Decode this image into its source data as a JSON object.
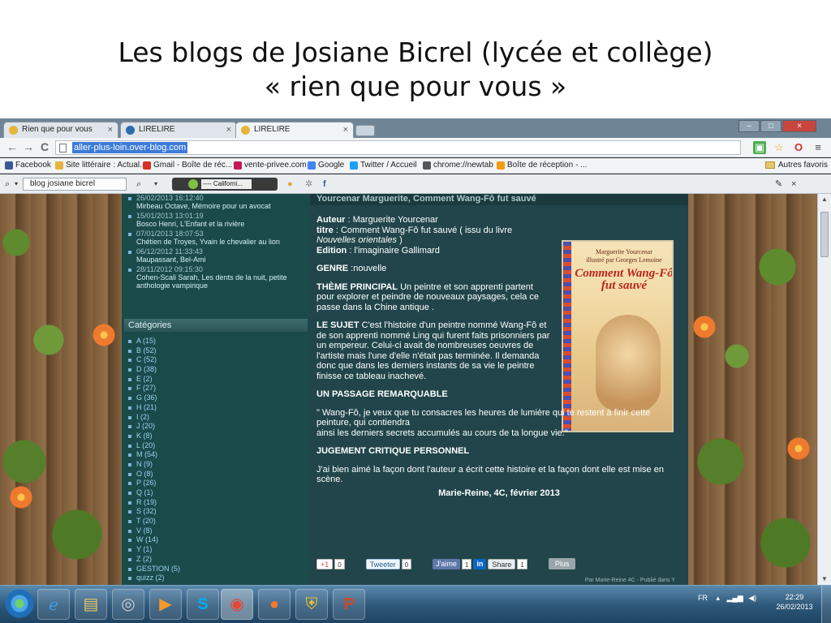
{
  "slide": {
    "title_line1": "Les blogs de Josiane Bicrel (lycée et collège)",
    "title_line2": "« rien que pour vous »"
  },
  "browser": {
    "tabs": [
      {
        "label": "Rien que pour vous",
        "active": false
      },
      {
        "label": "LIRELIRE",
        "active": false
      },
      {
        "label": "LIRELIRE",
        "active": true
      }
    ],
    "tab_close": "×",
    "window_controls": {
      "minimize": "–",
      "maximize": "□",
      "close": "×"
    },
    "nav": {
      "back": "←",
      "forward": "→",
      "reload": "C"
    },
    "url": "aller-plus-loin.over-blog.com",
    "bookmarks": [
      {
        "label": "Facebook",
        "color": "#3b5998"
      },
      {
        "label": "Site littéraire : Actual...",
        "color": "#e8b43a"
      },
      {
        "label": "Gmail - Boîte de réc...",
        "color": "#d93025"
      },
      {
        "label": "vente-privee.com",
        "color": "#c2185b"
      },
      {
        "label": "Google",
        "color": "#4285f4"
      },
      {
        "label": "Twitter / Accueil",
        "color": "#1da1f2"
      },
      {
        "label": "chrome://newtab",
        "color": "#555555"
      },
      {
        "label": "Boîte de réception - ...",
        "color": "#f39c12"
      }
    ],
    "other_bookmarks": "Autres favoris",
    "search_query": "blog josiane bicrel",
    "player_station": "---- Californi..."
  },
  "sidebar": {
    "recent": [
      {
        "date": "26/02/2013 16:12:40",
        "title": "Mirbeau Octave, Mémoire pour un avocat"
      },
      {
        "date": "15/01/2013 13:01:19",
        "title": "Bosco Henri, L'Enfant et la rivière"
      },
      {
        "date": "07/01/2013 18:07:53",
        "title": "Chétien de Troyes, Yvain le chevalier au lion"
      },
      {
        "date": "06/12/2012 11:33:43",
        "title": "Maupassant, Bel-Ami"
      },
      {
        "date": "28/11/2012 09:15:30",
        "title": "Cohen-Scali Sarah, Les dents de la nuit, petite anthologie vampirique"
      }
    ],
    "categories_header": "Catégories",
    "categories": [
      "A (15)",
      "B (52)",
      "C (52)",
      "D (38)",
      "E (2)",
      "F (27)",
      "G (36)",
      "H (21)",
      "I (2)",
      "J (20)",
      "K (8)",
      "L (20)",
      "M (54)",
      "N (9)",
      "O (8)",
      "P (26)",
      "Q (1)",
      "R (19)",
      "S (32)",
      "T (20)",
      "V (8)",
      "W (14)",
      "Y (1)",
      "Z (2)",
      "GESTION (5)",
      "quizz (2)"
    ]
  },
  "post": {
    "heading": "Yourcenar Marguerite, Comment Wang-Fô fut sauvé",
    "author_label": "Auteur",
    "author": " : Marguerite Yourcenar",
    "titre_label": "titre",
    "titre": "  : Comment  Wang-Fô fut sauvé ( issu du livre ",
    "titre_book": "Nouvelles orientales",
    "titre_end": " )",
    "edition_label": "Edition",
    "edition": "  : l'imaginaire Gallimard",
    "genre_label": "GENRE",
    "genre": " :nouvelle",
    "theme_label": "THÈME PRINCIPAL",
    "theme": " Un peintre et son apprenti partent pour explorer et peindre de nouveaux paysages, cela ce passe dans la Chine antique .",
    "sujet_label": "LE SUJET",
    "sujet": " C'est l'histoire d'un peintre nommé Wang-Fô et de son apprenti nommé Ling qui furent faits prisonniers par un empereur. Celui-ci avait de nombreuses oeuvres de l'artiste mais l'une d'elle n'était pas terminée. Il demanda donc que dans les derniers instants de sa vie le peintre finisse ce tableau inachevé.",
    "passage_label": "UN PASSAGE REMARQUABLE",
    "passage_line1": "\" Wang-Fô, je veux que tu consacres les heures de lumière qui te restent à finir cette peinture, qui contiendra",
    "passage_line2": "ainsi les derniers secrets accumulés au cours de ta longue vie.\"",
    "jugement_label": "JUGEMENT CRITIQUE PERSONNEL",
    "jugement": "J'ai bien aimé la façon dont l'auteur a écrit cette histoire et la façon dont elle est mise en scène.",
    "signature": "Marie-Reine, 4C, février 2013",
    "book_cover": {
      "author": "Marguerite Yourcenar",
      "illustrator": "illustré par Georges Lemoine",
      "title": "Comment Wang-Fô fut sauvé"
    },
    "social": {
      "gplus": "+1",
      "gplus_count": "0",
      "tweet": "Tweeter",
      "tweet_count": "0",
      "like": "J'aime",
      "like_count": "1",
      "share": "Share",
      "share_count": "1",
      "plus": "Plus"
    },
    "footer": "Par Marie-Reine 4C - Publié dans Y"
  },
  "taskbar": {
    "language": "FR",
    "time": "22:29",
    "date": "26/02/2013",
    "apps": [
      "ie",
      "explorer",
      "media",
      "media-player",
      "skype",
      "chrome",
      "firefox",
      "security",
      "powerpoint"
    ]
  }
}
